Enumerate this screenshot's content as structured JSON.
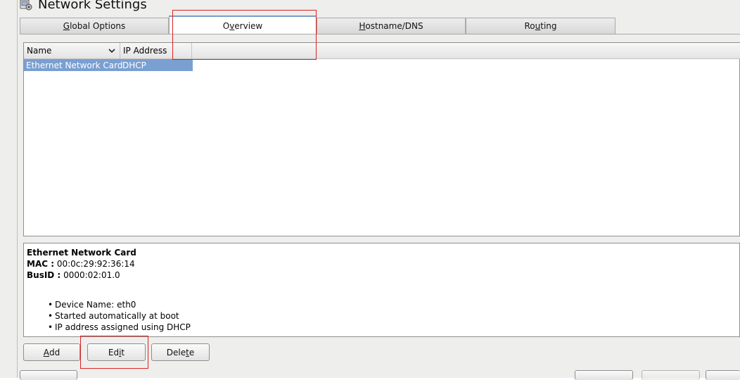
{
  "window": {
    "title": "Network Settings"
  },
  "tabs": [
    {
      "label_pre": "",
      "label_u": "G",
      "label_post": "lobal Options"
    },
    {
      "label_pre": "O",
      "label_u": "v",
      "label_post": "erview"
    },
    {
      "label_pre": "",
      "label_u": "H",
      "label_post": "ostname/DNS"
    },
    {
      "label_pre": "Ro",
      "label_u": "u",
      "label_post": "ting"
    }
  ],
  "table": {
    "headers": [
      "Name",
      "IP Address"
    ],
    "rows": [
      {
        "name": "Ethernet Network Card",
        "ip": "DHCP"
      }
    ]
  },
  "details": {
    "title": "Ethernet Network Card",
    "mac_label": "MAC :",
    "mac_value": "00:0c:29:92:36:14",
    "busid_label": "BusID :",
    "busid_value": "0000:02:01.0",
    "bullets": [
      "Device Name: eth0",
      "Started automatically at boot",
      "IP address assigned using DHCP"
    ]
  },
  "buttons": {
    "add": {
      "pre": "",
      "u": "A",
      "post": "dd"
    },
    "edit": {
      "pre": "Ed",
      "u": "i",
      "post": "t"
    },
    "delete": {
      "pre": "Dele",
      "u": "t",
      "post": "e"
    }
  },
  "colors": {
    "selected_row": "#7a9fd1",
    "highlight": "#dd2222"
  }
}
